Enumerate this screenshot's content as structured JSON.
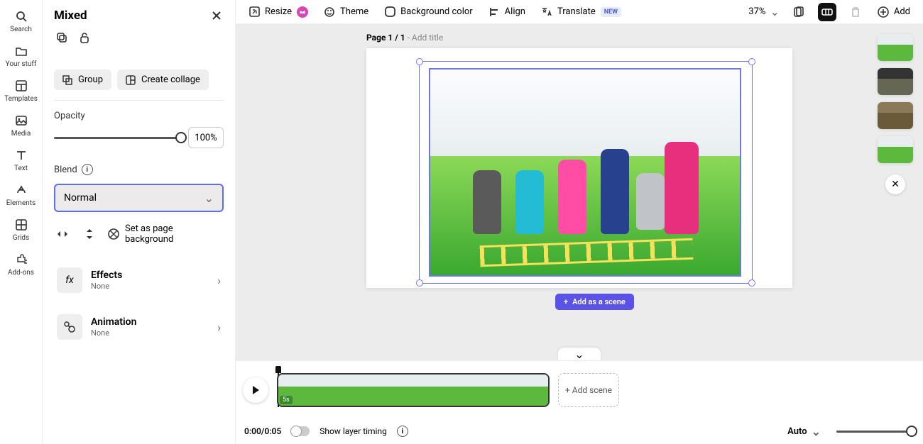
{
  "rail": {
    "search": "Search",
    "your_stuff": "Your stuff",
    "templates": "Templates",
    "media": "Media",
    "text": "Text",
    "elements": "Elements",
    "grids": "Grids",
    "addons": "Add-ons"
  },
  "panel": {
    "title": "Mixed",
    "group": "Group",
    "create_collage": "Create collage",
    "opacity_label": "Opacity",
    "opacity_value": "100%",
    "blend_label": "Blend",
    "blend_value": "Normal",
    "set_bg": "Set as page background",
    "effects": {
      "title": "Effects",
      "sub": "None"
    },
    "animation": {
      "title": "Animation",
      "sub": "None"
    }
  },
  "toolbar": {
    "resize": "Resize",
    "theme": "Theme",
    "bg_color": "Background color",
    "align": "Align",
    "translate": "Translate",
    "new_badge": "NEW",
    "zoom": "37%",
    "add": "Add"
  },
  "canvas": {
    "page_prefix": "Page 1 / 1",
    "add_title": " - Add title",
    "add_as_scene": "Add as a scene"
  },
  "timeline": {
    "scene_duration": "5s",
    "add_scene": "+ Add scene",
    "time": "0:00/0:05",
    "show_layer_timing": "Show layer timing",
    "auto": "Auto"
  }
}
